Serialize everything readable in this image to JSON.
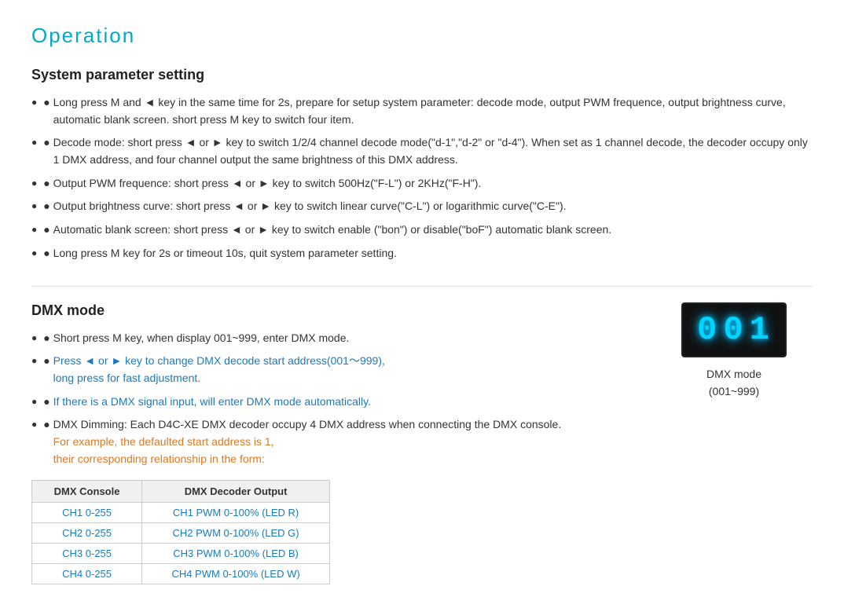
{
  "page": {
    "title": "Operation"
  },
  "system_param_section": {
    "title": "System parameter setting",
    "bullets": [
      {
        "text": "Long press M and ◄ key in the same time for 2s, prepare for setup system parameter: decode mode, output PWM frequence, output brightness curve, automatic blank screen. short press M key to switch four item.",
        "style": "normal"
      },
      {
        "text": "Decode mode: short press ◄ or ► key to switch 1/2/4 channel decode mode(\"d-1\",\"d-2\" or \"d-4\"). When set as 1 channel decode, the decoder occupy only 1 DMX address, and four channel output the same brightness of this DMX address.",
        "style": "normal"
      },
      {
        "text": "Output PWM frequence: short press ◄ or ► key to switch 500Hz(\"F-L\") or 2KHz(\"F-H\").",
        "style": "normal"
      },
      {
        "text": "Output brightness curve: short press ◄ or ► key to switch linear curve(\"C-L\") or logarithmic curve(\"C-E\").",
        "style": "normal"
      },
      {
        "text": "Automatic blank screen: short press ◄ or ► key to switch enable (\"bon\") or disable(\"boF\") automatic blank screen.",
        "style": "normal"
      },
      {
        "text": "Long press M key for 2s or timeout 10s, quit system parameter setting.",
        "style": "normal"
      }
    ]
  },
  "dmx_section": {
    "title": "DMX mode",
    "bullets": [
      {
        "text": "Short press M key, when display 001~999, enter DMX mode.",
        "style": "normal"
      },
      {
        "text": "Press  ◄ or ► key to change DMX decode start address(001～999), long press for fast adjustment.",
        "style": "blue",
        "text_line2": "long press for fast adjustment."
      },
      {
        "text": "If there is a DMX signal input, will enter DMX mode automatically.",
        "style": "blue"
      },
      {
        "text": "DMX Dimming: Each D4C-XE DMX decoder occupy 4 DMX address when connecting the DMX console.",
        "text_line2": "For example, the defaulted start address is 1,",
        "text_line3": "their corresponding relationship in the form:",
        "style": "mixed"
      }
    ],
    "led_digits": "001",
    "led_label_line1": "DMX mode",
    "led_label_line2": "(001~999)",
    "table": {
      "headers": [
        "DMX Console",
        "DMX Decoder Output"
      ],
      "rows": [
        {
          "console": "CH1 0-255",
          "output": "CH1 PWM 0-100% (LED R)"
        },
        {
          "console": "CH2 0-255",
          "output": "CH2 PWM 0-100% (LED G)"
        },
        {
          "console": "CH3 0-255",
          "output": "CH3 PWM 0-100% (LED B)"
        },
        {
          "console": "CH4 0-255",
          "output": "CH4 PWM 0-100% (LED W)"
        }
      ]
    }
  }
}
